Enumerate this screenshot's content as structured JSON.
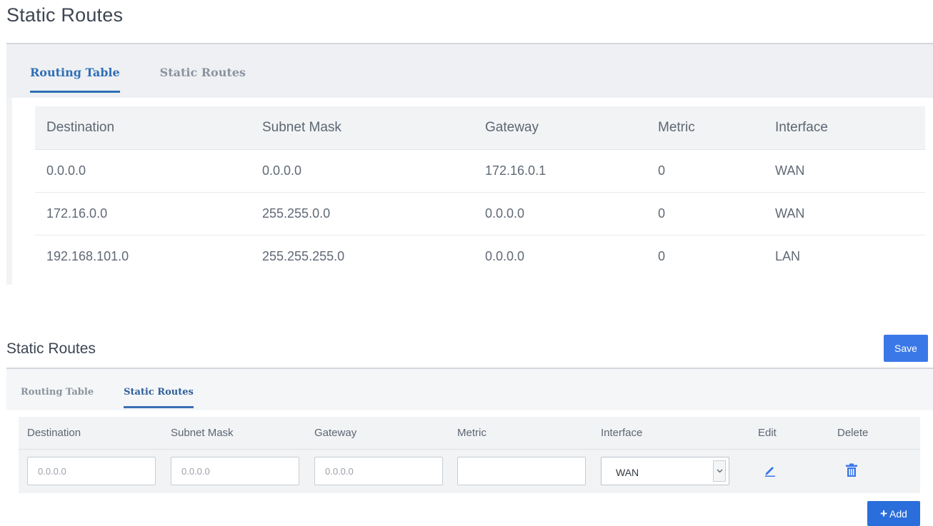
{
  "page_title": "Static Routes",
  "top": {
    "tabs": [
      {
        "label": "Routing Table",
        "active": true
      },
      {
        "label": "Static Routes",
        "active": false
      }
    ],
    "routing_table": {
      "headers": [
        "Destination",
        "Subnet Mask",
        "Gateway",
        "Metric",
        "Interface"
      ],
      "rows": [
        [
          "0.0.0.0",
          "0.0.0.0",
          "172.16.0.1",
          "0",
          "WAN"
        ],
        [
          "172.16.0.0",
          "255.255.0.0",
          "0.0.0.0",
          "0",
          "WAN"
        ],
        [
          "192.168.101.0",
          "255.255.255.0",
          "0.0.0.0",
          "0",
          "LAN"
        ]
      ]
    }
  },
  "bottom": {
    "title": "Static Routes",
    "save_label": "Save",
    "tabs": [
      {
        "label": "Routing Table",
        "active": false
      },
      {
        "label": "Static Routes",
        "active": true
      }
    ],
    "table": {
      "headers": [
        "Destination",
        "Subnet Mask",
        "Gateway",
        "Metric",
        "Interface",
        "Edit",
        "Delete"
      ],
      "row": {
        "destination_placeholder": "0.0.0.0",
        "subnet_placeholder": "0.0.0.0",
        "gateway_placeholder": "0.0.0.0",
        "metric_value": "",
        "interface_value": "WAN"
      }
    },
    "add_label": "Add"
  },
  "colors": {
    "accent": "#3b78e7",
    "tab_active": "#2f6fb5",
    "panel_bg": "#eef0f3"
  },
  "icons": {
    "edit": "pencil-icon",
    "delete": "trash-icon",
    "add": "plus-icon",
    "select": "chevron-down-icon"
  }
}
